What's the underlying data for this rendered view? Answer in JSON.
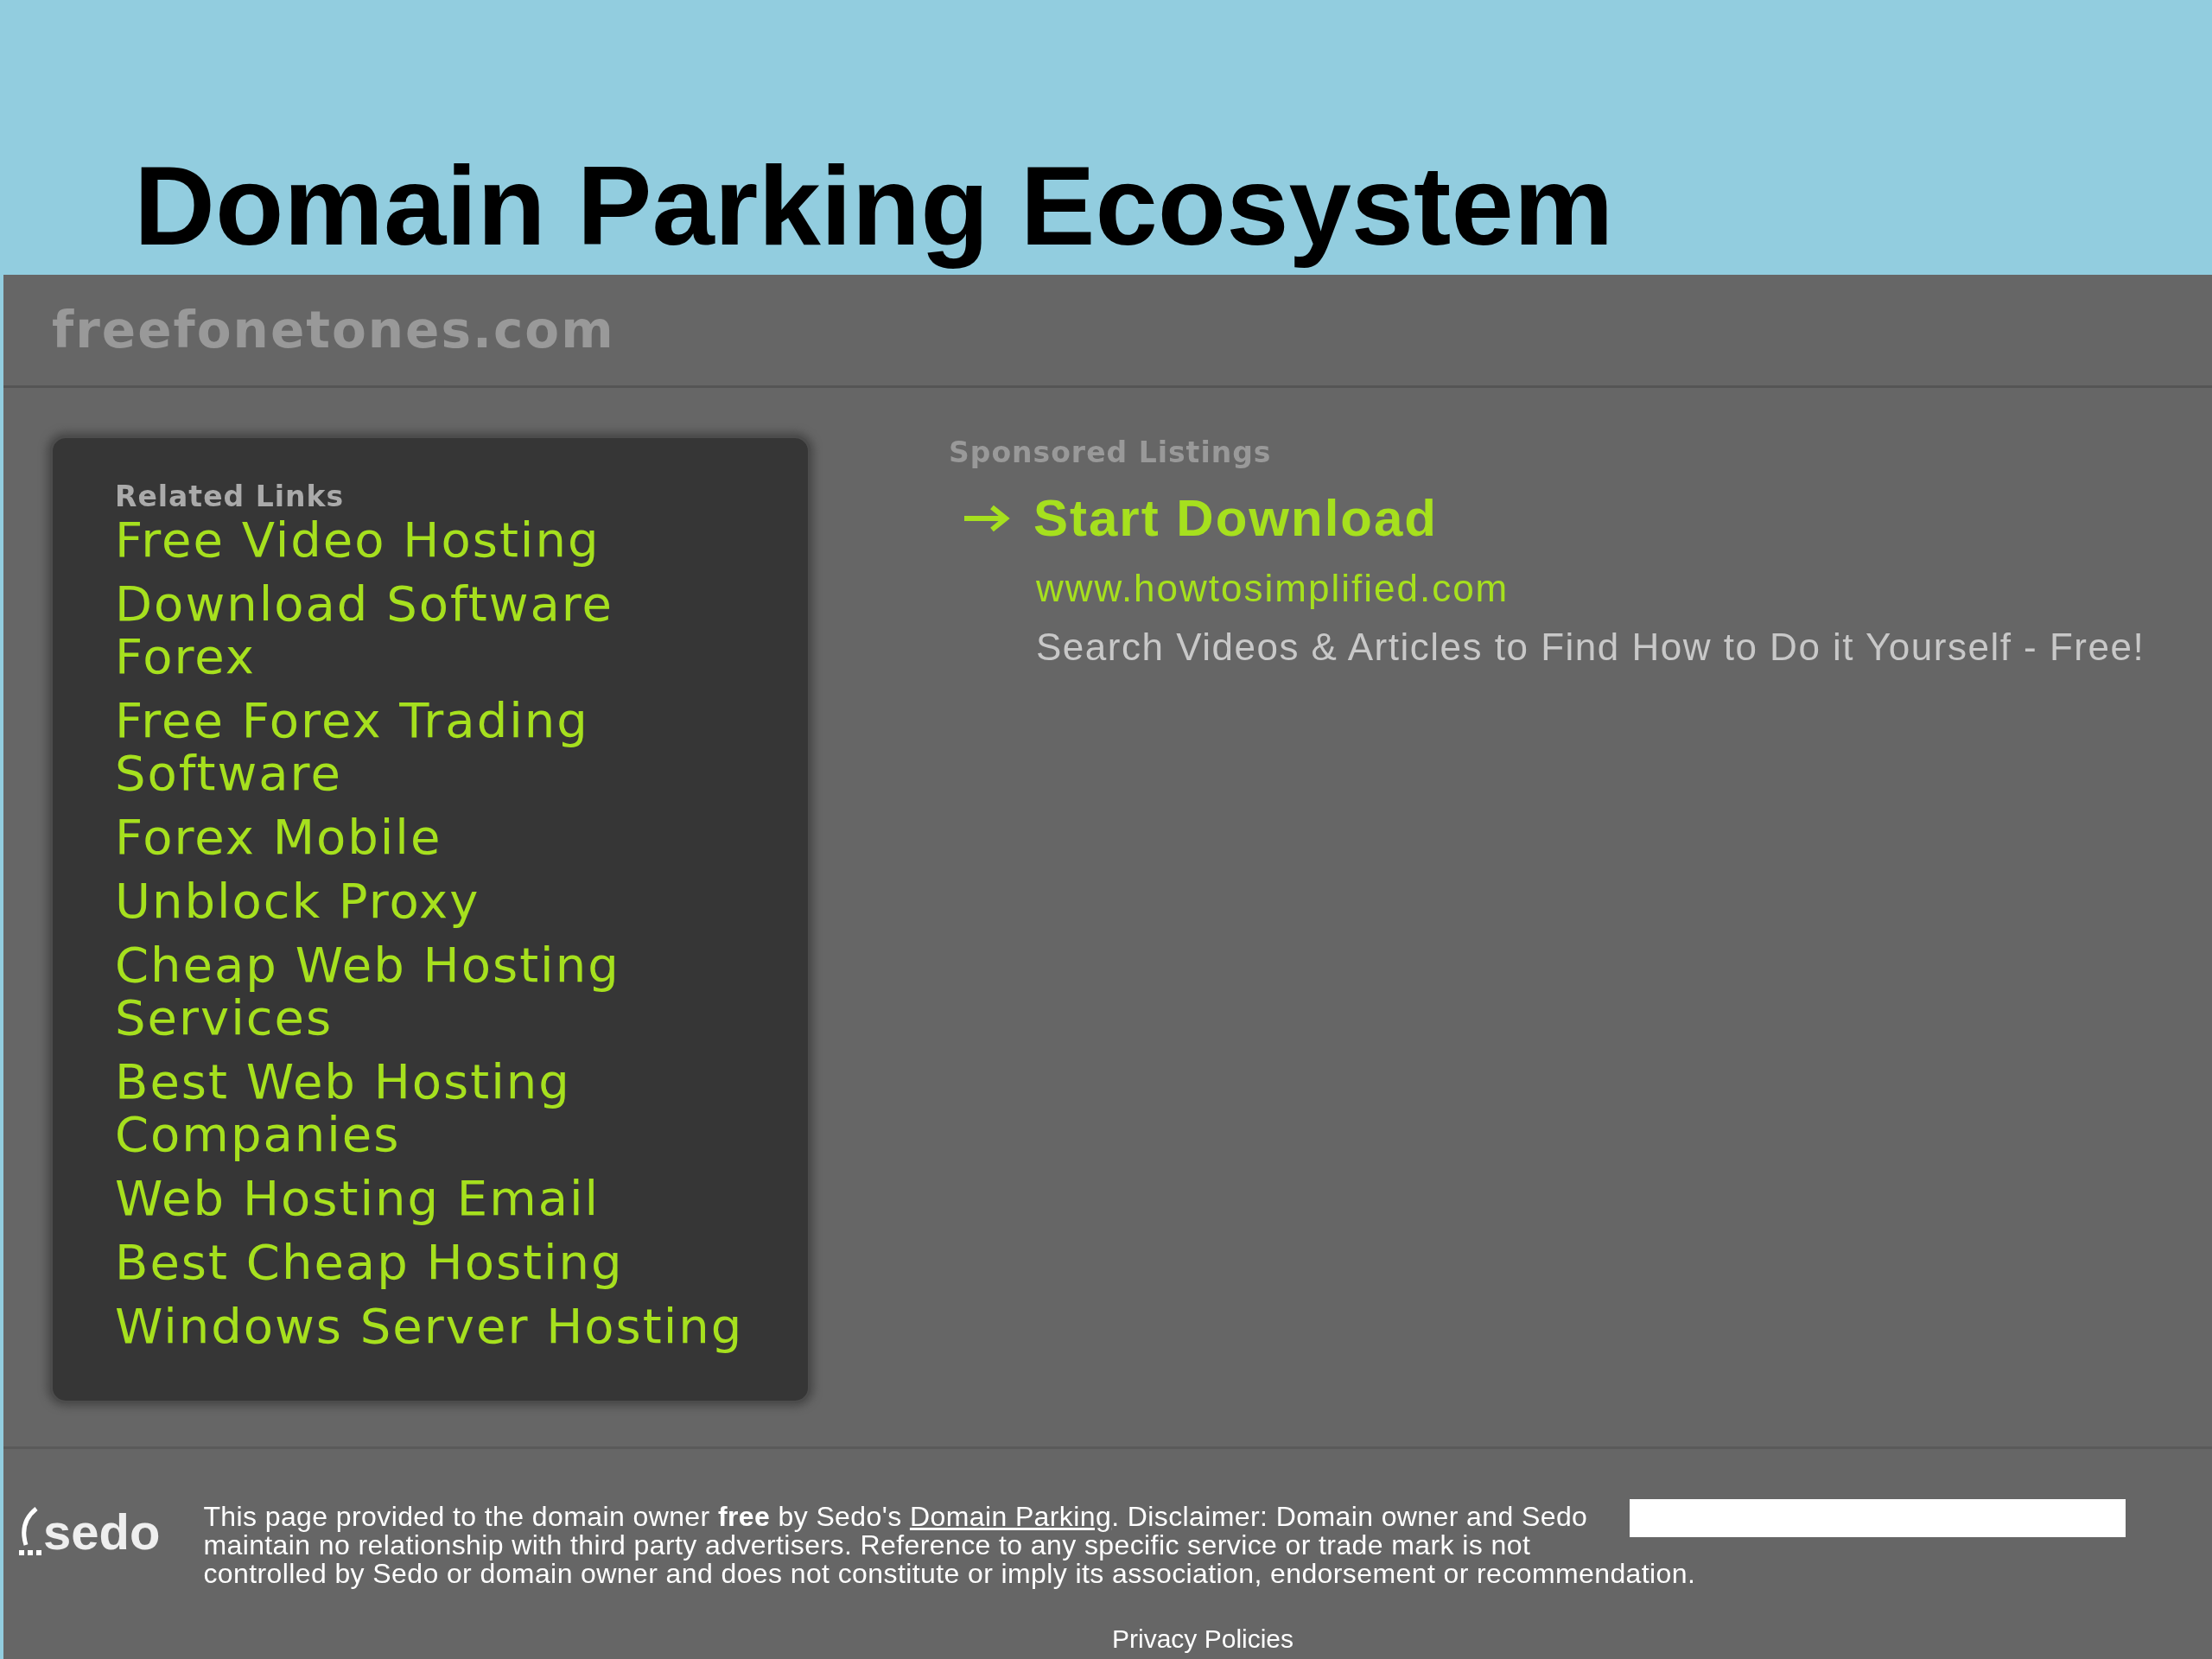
{
  "slide_title": "Domain Parking Ecosystem",
  "page": {
    "domain": "freefonetones.com",
    "related_links": {
      "heading": "Related Links",
      "links": [
        {
          "label": "Free Video Hosting"
        },
        {
          "label": "Download Software Forex"
        },
        {
          "label": "Free Forex Trading Software"
        },
        {
          "label": "Forex Mobile"
        },
        {
          "label": "Unblock Proxy"
        },
        {
          "label": "Cheap Web Hosting Services"
        },
        {
          "label": "Best Web Hosting Companies"
        },
        {
          "label": "Web Hosting Email"
        },
        {
          "label": "Best Cheap Hosting"
        },
        {
          "label": "Windows Server Hosting"
        }
      ]
    },
    "sponsored": {
      "heading": "Sponsored Listings",
      "listings": [
        {
          "title": "Start Download",
          "url": "www.howtosimplified.com",
          "description": "Search Videos & Articles to Find How to Do it Yourself - Free!"
        }
      ]
    },
    "footer": {
      "logo": "sedo",
      "disclaimer_before": "This page provided to the domain owner **free** by Sedo's",
      "link": "Domain Parking",
      "disclaimer_after": ". Disclaimer: Domain owner and Sedo maintain no relationship with third party advertisers. Reference to any specific service or trade mark is not controlled by Sedo or domain owner and does not constitute or imply its association, endorsement or recommendation.",
      "privacy": "Privacy Policies"
    }
  }
}
